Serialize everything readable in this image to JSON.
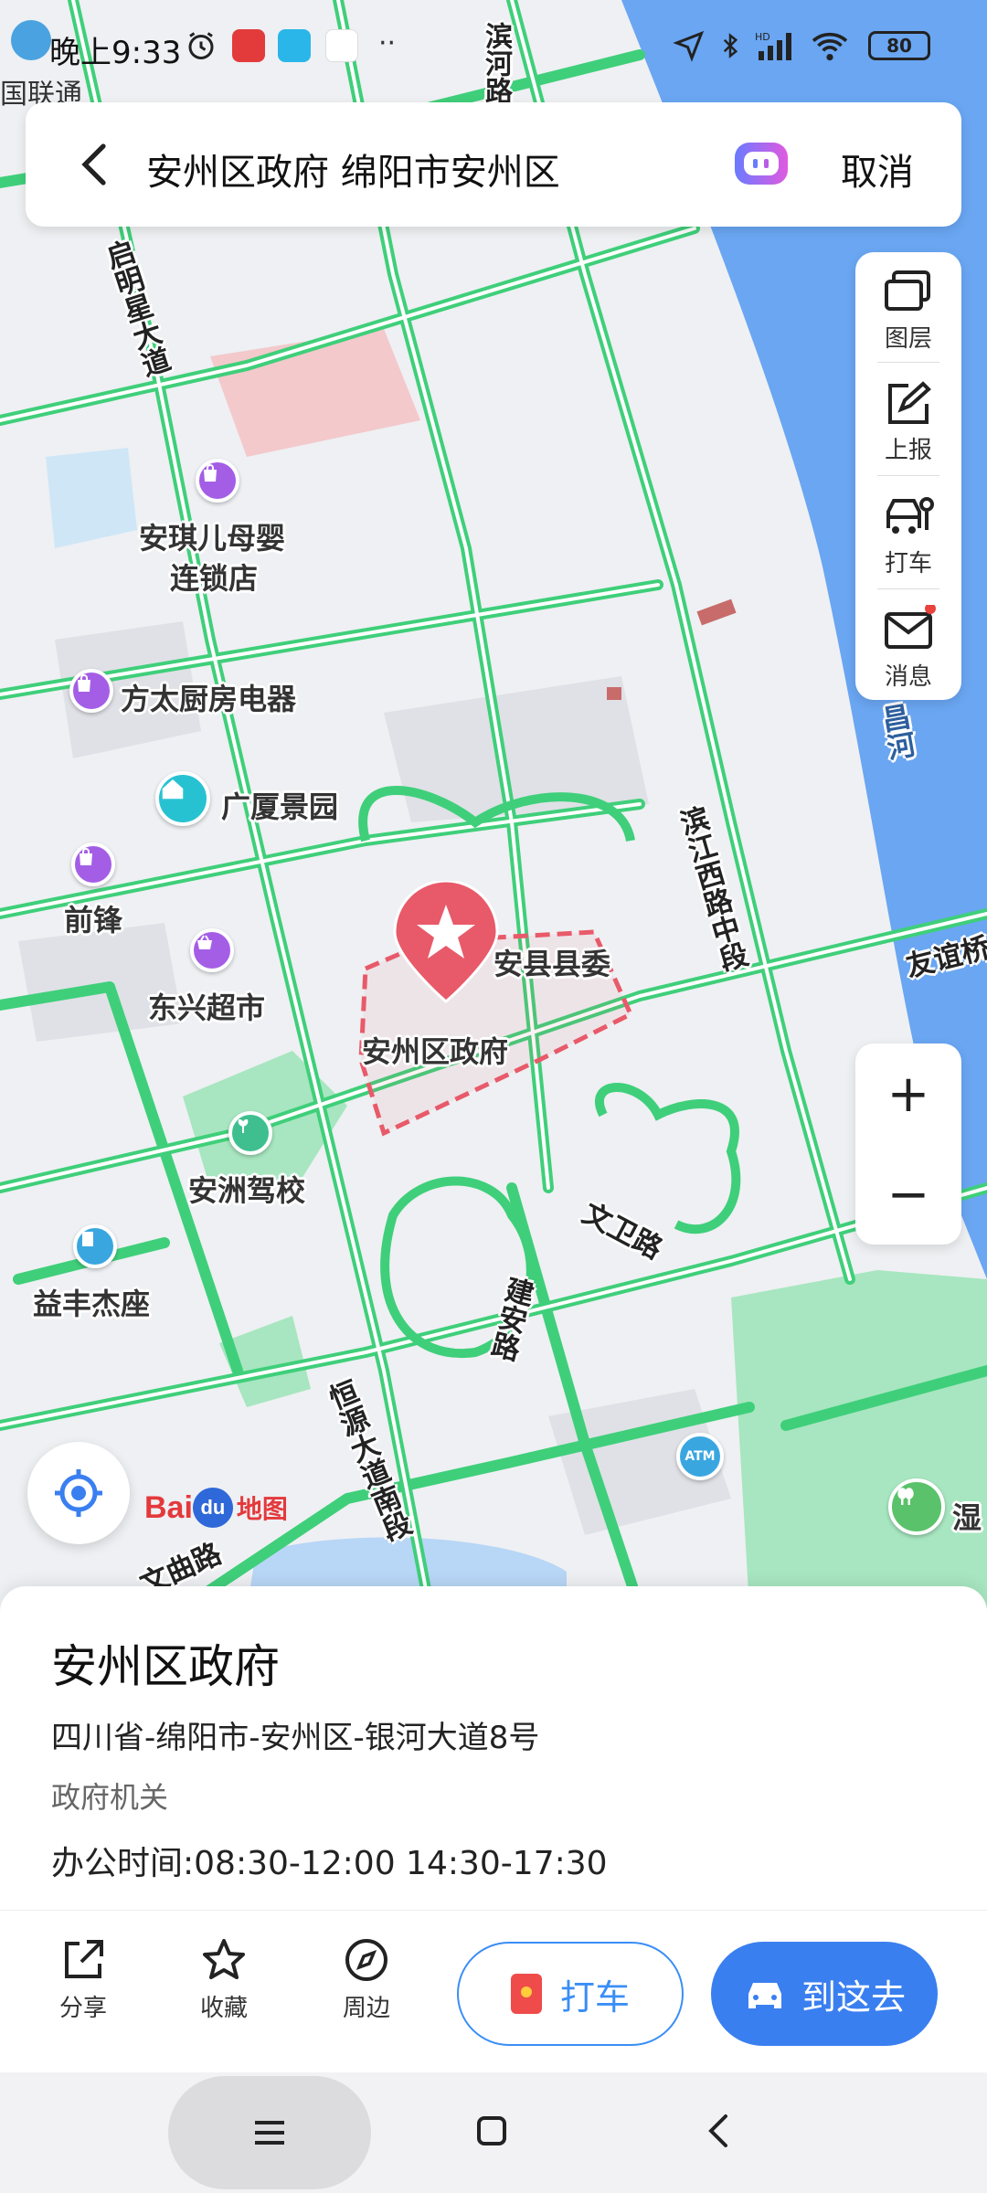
{
  "status_bar": {
    "time": "晚上9:33",
    "carrier": "国联通",
    "battery": "80",
    "icons": [
      "app-icon",
      "alarm-icon",
      "netease-music-icon",
      "send-icon",
      "baidu-map-icon",
      "more-dots-icon",
      "location-arrow-icon",
      "bluetooth-icon",
      "hd-signal-icon",
      "wifi-icon",
      "battery-icon"
    ]
  },
  "search": {
    "query": "安州区政府 绵阳市安州区",
    "cancel_label": "取消"
  },
  "tools": [
    {
      "label": "图层",
      "icon": "layers-icon"
    },
    {
      "label": "上报",
      "icon": "report-icon"
    },
    {
      "label": "打车",
      "icon": "taxi-icon"
    },
    {
      "label": "消息",
      "icon": "message-icon"
    }
  ],
  "zoom": {
    "in": "+",
    "out": "−"
  },
  "map": {
    "pois": {
      "anqier": "安琪儿母婴",
      "anqier_2": "连锁店",
      "fangtai": "方太厨房电器",
      "guangxia": "广厦景园",
      "qianfeng": "前锋",
      "dongxing": "东兴超市",
      "anzhou_school": "安洲驾校",
      "yifeng": "益丰杰座",
      "anxian": "安县县委",
      "government": "安州区政府",
      "shi": "湿"
    },
    "roads": {
      "qimingxing": "启明星大道",
      "binhe": "滨河路",
      "binjiang": "滨江西路中段",
      "youyi": "友谊桥",
      "wenwei": "文卫路",
      "jianan": "建安路",
      "hengyuan": "恒源大道南段",
      "wenqu": "文曲路",
      "chang_river": "昌河"
    },
    "logo_text": "地图",
    "atm": "ATM"
  },
  "place": {
    "name": "安州区政府",
    "address": "四川省-绵阳市-安州区-银河大道8号",
    "category": "政府机关",
    "hours": "办公时间:08:30-12:00 14:30-17:30"
  },
  "actions": {
    "share": "分享",
    "favorite": "收藏",
    "nearby": "周边",
    "taxi": "打车",
    "goto": "到这去"
  },
  "colors": {
    "road_green": "#3fcf7a",
    "river_blue": "#6aa6f2",
    "accent_blue": "#3a7ff0",
    "marker_red": "#e85a6a",
    "poi_purple": "#a45ee6",
    "poi_cyan": "#27c2d2"
  }
}
